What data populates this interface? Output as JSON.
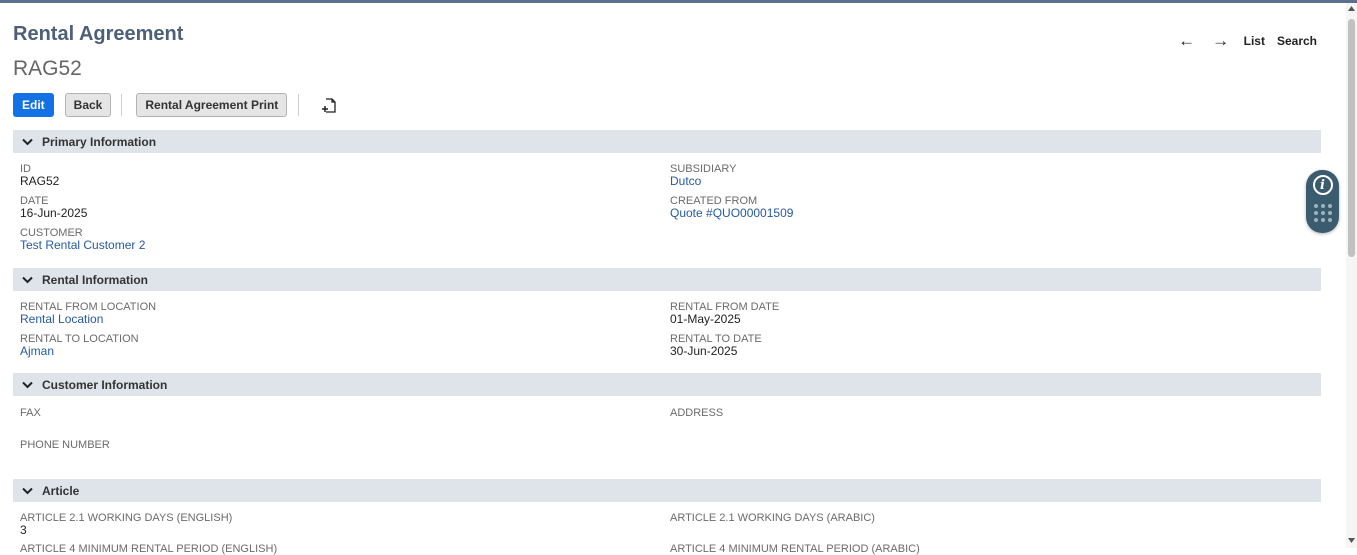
{
  "header": {
    "title": "Rental Agreement",
    "record_id": "RAG52"
  },
  "nav": {
    "prev_icon": "←",
    "next_icon": "→",
    "list_label": "List",
    "search_label": "Search"
  },
  "toolbar": {
    "edit_label": "Edit",
    "back_label": "Back",
    "print_label": "Rental Agreement Print"
  },
  "sections": {
    "primary": {
      "title": "Primary Information",
      "id_label": "ID",
      "id_value": "RAG52",
      "date_label": "DATE",
      "date_value": "16-Jun-2025",
      "customer_label": "CUSTOMER",
      "customer_value": "Test Rental Customer 2",
      "subsidiary_label": "SUBSIDIARY",
      "subsidiary_value": "Dutco",
      "created_from_label": "CREATED FROM",
      "created_from_value": "Quote #QUO00001509"
    },
    "rental": {
      "title": "Rental Information",
      "from_location_label": "RENTAL FROM LOCATION",
      "from_location_value": "Rental Location",
      "to_location_label": "RENTAL TO LOCATION",
      "to_location_value": "Ajman",
      "from_date_label": "RENTAL FROM DATE",
      "from_date_value": "01-May-2025",
      "to_date_label": "RENTAL TO DATE",
      "to_date_value": "30-Jun-2025"
    },
    "customer": {
      "title": "Customer Information",
      "fax_label": "FAX",
      "phone_label": "PHONE NUMBER",
      "address_label": "ADDRESS"
    },
    "article": {
      "title": "Article",
      "wd_en_label": "ARTICLE 2.1 WORKING DAYS (ENGLISH)",
      "wd_en_value": "3",
      "wd_ar_label": "ARTICLE 2.1 WORKING DAYS (ARABIC)",
      "min_en_label": "ARTICLE 4 MINIMUM RENTAL PERIOD (ENGLISH)",
      "min_ar_label": "ARTICLE 4 MINIMUM RENTAL PERIOD (ARABIC)"
    }
  },
  "colors": {
    "primary_button": "#1271e5",
    "section_bg": "#dfe4eb",
    "link": "#255ba0",
    "title": "#4d5f79"
  }
}
